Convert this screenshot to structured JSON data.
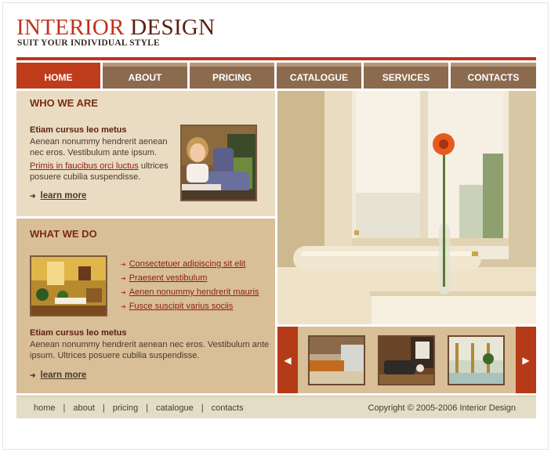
{
  "brand": {
    "title_word1": "INTERIOR",
    "title_word2": "DESIGN",
    "tagline": "SUIT YOUR INDIVIDUAL STYLE"
  },
  "nav": {
    "items": [
      "HOME",
      "ABOUT",
      "PRICING",
      "CATALOGUE",
      "SERVICES",
      "CONTACTS"
    ],
    "active": "HOME"
  },
  "who_we_are": {
    "heading": "WHO WE ARE",
    "bold_title": "Etiam cursus leo metus",
    "text1": "Aenean nonummy hendrerit aenean",
    "text2": "nec eros. Vestibulum ante ipsum.",
    "link_text": "Primis in faucibus orci luctus",
    "text3_after_link": " ultrices",
    "text4": "posuere cubilia suspendisse.",
    "more_label": "learn more"
  },
  "what_we_do": {
    "heading": "WHAT WE DO",
    "links": [
      "Consectetuer adipiscing sit elit",
      "Praesent vestibulum",
      "Aenen nonummy hendrerit mauris ",
      "Fusce suscipit varius sociis "
    ],
    "bold_title": "Etiam cursus leo metus",
    "text1": "Aenean nonummy hendrerit aenean nec eros. Vestibulum ante",
    "text2": "ipsum. Ultrices posuere cubilia suspendisse.",
    "more_label": "learn more"
  },
  "gallery": {
    "prev_icon": "arrow-left-icon",
    "next_icon": "arrow-right-icon"
  },
  "footer": {
    "links": [
      "home",
      "about",
      "pricing",
      "catalogue",
      "contacts"
    ],
    "separator": "|",
    "copyright": "Copyright © 2005-2006 Interior Design"
  },
  "colors": {
    "accent": "#c0321a",
    "nav_brown": "#8b6a4e",
    "panel_light": "#e9dcc3",
    "panel_dark": "#d8bf98"
  }
}
